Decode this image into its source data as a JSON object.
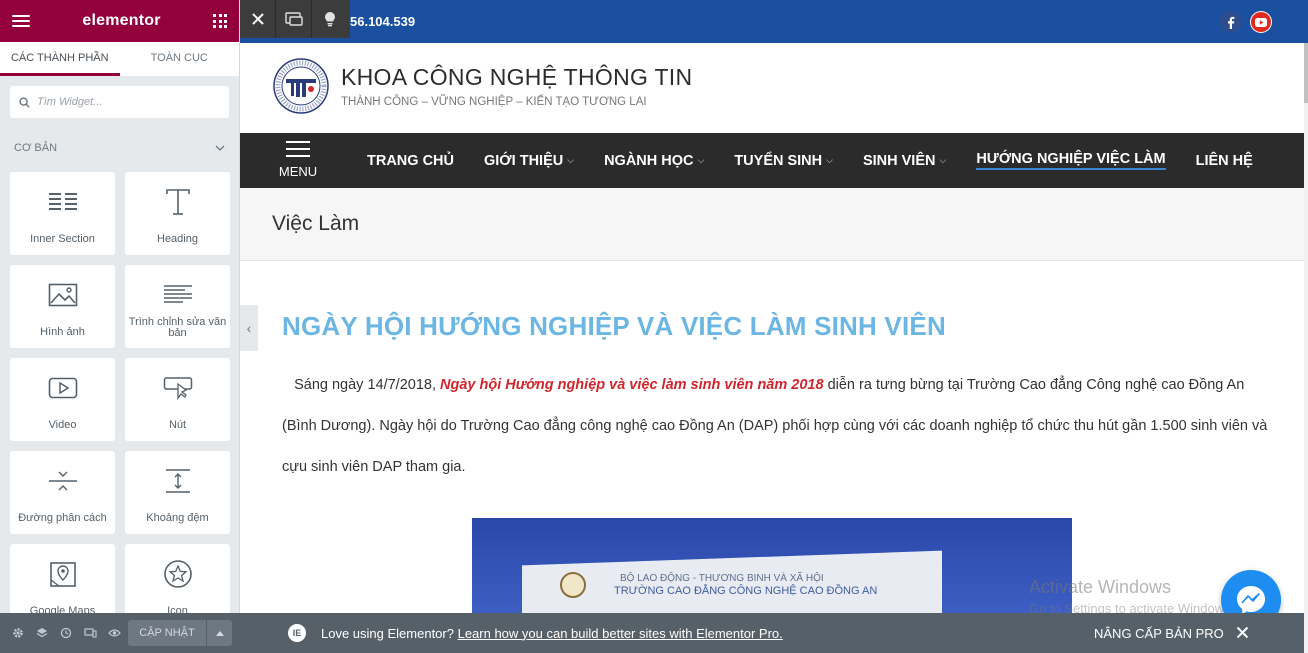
{
  "panel": {
    "logo": "elementor",
    "tabs": [
      {
        "label": "CÁC THÀNH PHẦN",
        "active": true
      },
      {
        "label": "TOÀN CỤC",
        "active": false
      }
    ],
    "search": {
      "placeholder": "Tìm Widget..."
    },
    "category": "CƠ BẢN",
    "widgets": [
      {
        "label": "Inner Section",
        "icon": "inner-section-icon"
      },
      {
        "label": "Heading",
        "icon": "heading-icon"
      },
      {
        "label": "Hình ảnh",
        "icon": "image-icon"
      },
      {
        "label": "Trình chỉnh sửa văn bản",
        "icon": "text-editor-icon"
      },
      {
        "label": "Video",
        "icon": "video-icon"
      },
      {
        "label": "Nút",
        "icon": "button-icon"
      },
      {
        "label": "Đường phân cách",
        "icon": "divider-icon"
      },
      {
        "label": "Khoảng đệm",
        "icon": "spacer-icon"
      },
      {
        "label": "Google Maps",
        "icon": "map-icon"
      },
      {
        "label": "Icon",
        "icon": "star-icon"
      }
    ],
    "footer": {
      "update_label": "CẬP NHẬT"
    }
  },
  "site": {
    "phone": "56.104.539",
    "title": "KHOA CÔNG NGHỆ THÔNG TIN",
    "tagline": "THÀNH CÔNG – VỮNG NGHIỆP – KIẾN TẠO TƯƠNG LAI",
    "menu_label": "MENU",
    "nav": [
      {
        "label": "TRANG CHỦ",
        "dropdown": false,
        "active": false
      },
      {
        "label": "GIỚI THIỆU",
        "dropdown": true,
        "active": false
      },
      {
        "label": "NGÀNH HỌC",
        "dropdown": true,
        "active": false
      },
      {
        "label": "TUYỂN SINH",
        "dropdown": true,
        "active": false
      },
      {
        "label": "SINH VIÊN",
        "dropdown": true,
        "active": false
      },
      {
        "label": "HƯỚNG NGHIỆP VIỆC LÀM",
        "dropdown": false,
        "active": true
      },
      {
        "label": "LIÊN HỆ",
        "dropdown": false,
        "active": false
      }
    ],
    "page_heading": "Việc Làm",
    "colors": {
      "topbar": "#1b4fa0",
      "nav": "#2b2b2b",
      "title": "#6cb6e3",
      "highlight": "#d0262d"
    }
  },
  "article": {
    "title": "NGÀY HỘI HƯỚNG NGHIỆP VÀ VIỆC LÀM SINH VIÊN",
    "intro": "Sáng ngày 14/7/2018, ",
    "highlight": "Ngày hội Hướng nghiệp và việc làm sinh viên năm 2018",
    "rest": " diễn ra tưng bừng tại Trường Cao đẳng Công nghệ cao Đồng An (Bình Dương). Ngày hội do Trường Cao đẳng công nghệ cao Đồng An (DAP) phối hợp cùng với các doanh nghiệp tổ chức thu hút gần 1.500 sinh viên và cựu sinh viên DAP tham gia.",
    "image_text_1": "BỘ LAO ĐỘNG - THƯƠNG BINH VÀ XÃ HỘI",
    "image_text_2": "TRƯỜNG CAO ĐẲNG CÔNG NGHỆ CAO ĐỒNG AN"
  },
  "overlay": {
    "watermark_title": "Activate Windows",
    "watermark_sub": "Go to Settings to activate Windows."
  },
  "promo": {
    "text": "Love using Elementor? ",
    "link": "Learn how you can build better sites with Elementor Pro.",
    "upgrade": "NÂNG CẤP BẢN PRO"
  }
}
